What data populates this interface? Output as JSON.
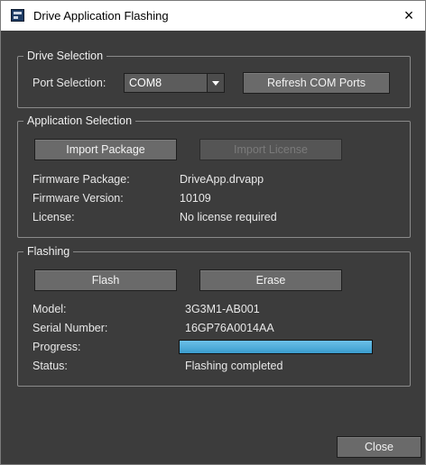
{
  "window": {
    "title": "Drive Application Flashing",
    "close_glyph": "×",
    "icon": "app-icon"
  },
  "drive_selection": {
    "title": "Drive Selection",
    "port_label": "Port Selection:",
    "port_value": "COM8",
    "refresh_button": "Refresh COM Ports"
  },
  "application_selection": {
    "title": "Application Selection",
    "import_package_button": "Import Package",
    "import_license_button": "Import License",
    "rows": [
      {
        "label": "Firmware Package:",
        "value": "DriveApp.drvapp"
      },
      {
        "label": "Firmware Version:",
        "value": "10109"
      },
      {
        "label": "License:",
        "value": "No license required"
      }
    ]
  },
  "flashing": {
    "title": "Flashing",
    "flash_button": "Flash",
    "erase_button": "Erase",
    "model_label": "Model:",
    "model_value": "3G3M1-AB001",
    "serial_label": "Serial Number:",
    "serial_value": "16GP76A0014AA",
    "progress_label": "Progress:",
    "progress_fraction": 1.0,
    "status_label": "Status:",
    "status_value": "Flashing completed"
  },
  "footer": {
    "close_button": "Close"
  },
  "colors": {
    "background": "#3c3c3c",
    "progress": "#4aa8d8"
  }
}
